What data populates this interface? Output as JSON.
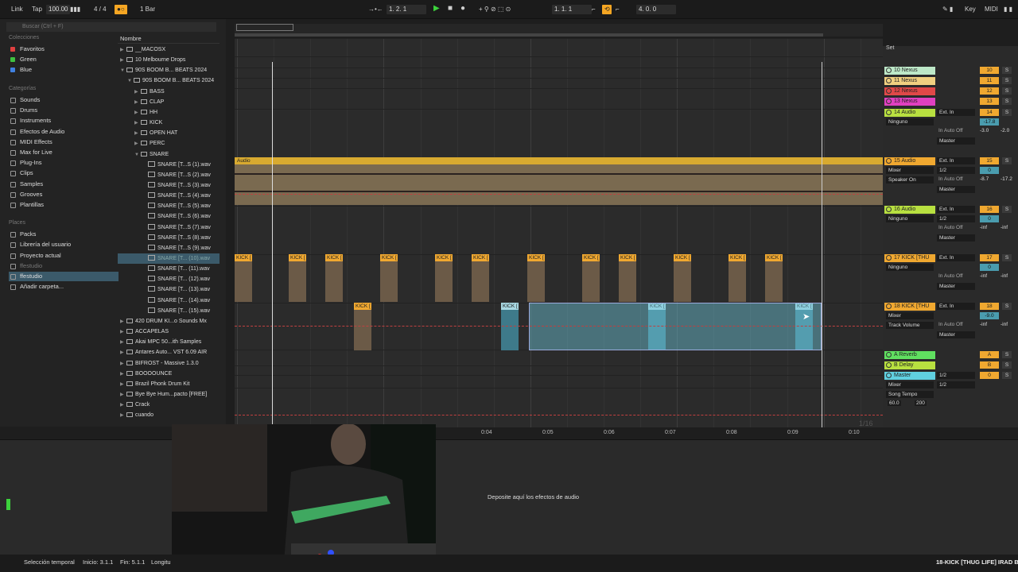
{
  "topbar": {
    "link": "Link",
    "tap": "Tap",
    "tempo": "100.00",
    "signature": "4 / 4",
    "metronome": "●○",
    "quantize": "1 Bar",
    "position": "1.   2.   1",
    "loop_start": "1.   1.   1",
    "loop_length": "4.   0.   0",
    "key": "Key",
    "midi": "MIDI"
  },
  "browser": {
    "search_placeholder": "Buscar (Ctrl + F)",
    "collections_header": "Colecciones",
    "collections": [
      {
        "label": "Favoritos",
        "color": "#e04040"
      },
      {
        "label": "Green",
        "color": "#40c040"
      },
      {
        "label": "Blue",
        "color": "#4080e0"
      }
    ],
    "categories_header": "Categorías",
    "categories": [
      "Sounds",
      "Drums",
      "Instruments",
      "Efectos de Audio",
      "MIDI Effects",
      "Max for Live",
      "Plug-Ins",
      "Clips",
      "Samples",
      "Grooves",
      "Plantillas"
    ],
    "places_header": "Places",
    "places": [
      "Packs",
      "Librería del usuario",
      "Proyecto actual",
      "ffestudio",
      "ffestudio",
      "Añadir carpeta..."
    ],
    "name_header": "Nombre",
    "files": [
      {
        "label": "__MACOSX",
        "indent": 0,
        "type": "folder"
      },
      {
        "label": "10 Melbourne Drops",
        "indent": 0,
        "type": "folder"
      },
      {
        "label": "90S BOOM B... BEATS 2024",
        "indent": 0,
        "type": "folder",
        "open": true
      },
      {
        "label": "90S BOOM B... BEATS 2024",
        "indent": 1,
        "type": "folder",
        "open": true
      },
      {
        "label": "BASS",
        "indent": 2,
        "type": "folder"
      },
      {
        "label": "CLAP",
        "indent": 2,
        "type": "folder"
      },
      {
        "label": "HH",
        "indent": 2,
        "type": "folder"
      },
      {
        "label": "KICK",
        "indent": 2,
        "type": "folder"
      },
      {
        "label": "OPEN HAT",
        "indent": 2,
        "type": "folder"
      },
      {
        "label": "PERC",
        "indent": 2,
        "type": "folder"
      },
      {
        "label": "SNARE",
        "indent": 2,
        "type": "folder",
        "open": true
      },
      {
        "label": "SNARE [T...S (1).wav",
        "indent": 3,
        "type": "wav"
      },
      {
        "label": "SNARE [T...S (2).wav",
        "indent": 3,
        "type": "wav"
      },
      {
        "label": "SNARE [T...S (3).wav",
        "indent": 3,
        "type": "wav"
      },
      {
        "label": "SNARE [T...S (4).wav",
        "indent": 3,
        "type": "wav"
      },
      {
        "label": "SNARE [T...S (5).wav",
        "indent": 3,
        "type": "wav"
      },
      {
        "label": "SNARE [T...S (6).wav",
        "indent": 3,
        "type": "wav"
      },
      {
        "label": "SNARE [T...S (7).wav",
        "indent": 3,
        "type": "wav"
      },
      {
        "label": "SNARE [T...S (8).wav",
        "indent": 3,
        "type": "wav"
      },
      {
        "label": "SNARE [T...S (9).wav",
        "indent": 3,
        "type": "wav"
      },
      {
        "label": "SNARE [T... (10).wav",
        "indent": 3,
        "type": "wav",
        "selected": true
      },
      {
        "label": "SNARE [T... (11).wav",
        "indent": 3,
        "type": "wav"
      },
      {
        "label": "SNARE [T... (12).wav",
        "indent": 3,
        "type": "wav"
      },
      {
        "label": "SNARE [T... (13).wav",
        "indent": 3,
        "type": "wav"
      },
      {
        "label": "SNARE [T... (14).wav",
        "indent": 3,
        "type": "wav"
      },
      {
        "label": "SNARE [T... (15).wav",
        "indent": 3,
        "type": "wav"
      },
      {
        "label": "420 DRUM KI...o Sounds Mx",
        "indent": 0,
        "type": "folder"
      },
      {
        "label": "ACCAPELAS",
        "indent": 0,
        "type": "folder"
      },
      {
        "label": "Akai MPC 50...ith Samples",
        "indent": 0,
        "type": "folder"
      },
      {
        "label": "Antares Auto... VST 6.09 AIR",
        "indent": 0,
        "type": "folder"
      },
      {
        "label": "BIFROST - Massive 1.3.0",
        "indent": 0,
        "type": "folder"
      },
      {
        "label": "BOOOOUNCE",
        "indent": 0,
        "type": "folder"
      },
      {
        "label": "Brazil Phonk Drum Kit",
        "indent": 0,
        "type": "folder"
      },
      {
        "label": "Bye Bye Hum...pacto [FREE]",
        "indent": 0,
        "type": "folder"
      },
      {
        "label": "Crack",
        "indent": 0,
        "type": "folder"
      },
      {
        "label": "cuando",
        "indent": 0,
        "type": "folder"
      }
    ]
  },
  "ruler": [
    "1",
    "1.2",
    "1.3",
    "1.4",
    "2",
    "2.2",
    "2.3",
    "2.4",
    "3",
    "3.2",
    "3.3",
    "3.4",
    "4",
    "4.2",
    "4.3",
    "4.4",
    "5",
    "5.2"
  ],
  "time_ruler": [
    "0:04",
    "0:05",
    "0:06",
    "0:07",
    "0:08",
    "0:09",
    "0:10"
  ],
  "audio_clip_label": "Audio",
  "kick_clip_label": "KICK [",
  "tracks": {
    "set_label": "Set",
    "items": [
      {
        "name": "10 Nexus",
        "color": "#bde8c8",
        "num": "10"
      },
      {
        "name": "11 Nexus",
        "color": "#f0d080",
        "num": "11"
      },
      {
        "name": "12 Nexus",
        "color": "#e04848",
        "num": "12"
      },
      {
        "name": "13 Nexus",
        "color": "#e040c0",
        "num": "13"
      },
      {
        "name": "14 Audio",
        "color": "#b8e040",
        "num": "14",
        "input": "Ext. In",
        "sub": "Ninguno",
        "route": "Master",
        "vol": "-17.8",
        "pan1": "-3.0",
        "pan2": "-2.0"
      },
      {
        "name": "15 Audio",
        "color": "#f0a830",
        "num": "15",
        "input": "Ext. In",
        "sub": "Mixer",
        "sub2": "Speaker On",
        "ch": "1/2",
        "route": "Master",
        "vol": "0",
        "pan1": "-8.7",
        "pan2": "-17.2"
      },
      {
        "name": "16 Audio",
        "color": "#b8e040",
        "num": "16",
        "input": "Ext. In",
        "sub": "Ninguno",
        "ch": "1/2",
        "route": "Master",
        "vol": "0",
        "pan1": "-inf",
        "pan2": "-inf"
      },
      {
        "name": "17 KICK [THU",
        "color": "#f0a830",
        "num": "17",
        "input": "Ext. In",
        "sub": "Ninguno",
        "route": "Master",
        "vol": "0",
        "pan1": "-inf",
        "pan2": "-inf"
      },
      {
        "name": "18 KICK [THU",
        "color": "#f0a830",
        "num": "18",
        "input": "Ext. In",
        "sub": "Mixer",
        "sub2": "Track Volume",
        "route": "Master",
        "vol": "-9.0",
        "pan1": "-inf",
        "pan2": "-inf"
      },
      {
        "name": "A Reverb",
        "color": "#60e060",
        "num": "A"
      },
      {
        "name": "B Delay",
        "color": "#b8e040",
        "num": "B"
      },
      {
        "name": "Master",
        "color": "#60d0e0",
        "num": "0",
        "input": "1/2",
        "sub": "Mixer",
        "sub2": "Song Tempo",
        "ch": "1/2",
        "tempo_min": "60.0",
        "tempo_max": "200"
      }
    ],
    "io_labels": {
      "in": "In",
      "auto": "Auto",
      "off": "Off"
    }
  },
  "bottom": {
    "drop_text": "Deposite aquí los efectos de audio",
    "zoom": "1/16"
  },
  "status": {
    "mode": "Selección temporal",
    "start": "Inicio: 3.1.1",
    "end": "Fin: 5.1.1",
    "length": "Longitu",
    "track": "18-KICK [THUG LIFE] IRAD BE"
  }
}
